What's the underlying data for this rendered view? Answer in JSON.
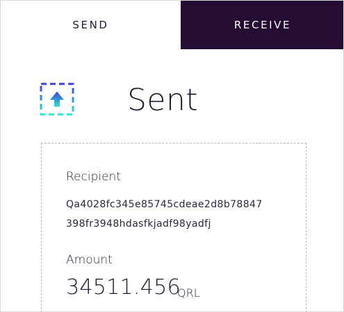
{
  "tabs": {
    "send_label": "SEND",
    "receive_label": "RECEIVE"
  },
  "status": {
    "title": "Sent",
    "icon": "upload-arrow-icon"
  },
  "details": {
    "recipient_label": "Recipient",
    "recipient_line_1": "Qa4028fc345e85745cdeae2d8b78847",
    "recipient_line_2": "398fr3948hdasfkjadf98yadfj",
    "amount_label": "Amount",
    "amount_value": "34511.456",
    "amount_unit": "QRL"
  },
  "colors": {
    "receive_tab_bg": "#240c32",
    "icon_gradient_start": "#3b3fd8",
    "icon_gradient_end": "#2ee6d6"
  }
}
